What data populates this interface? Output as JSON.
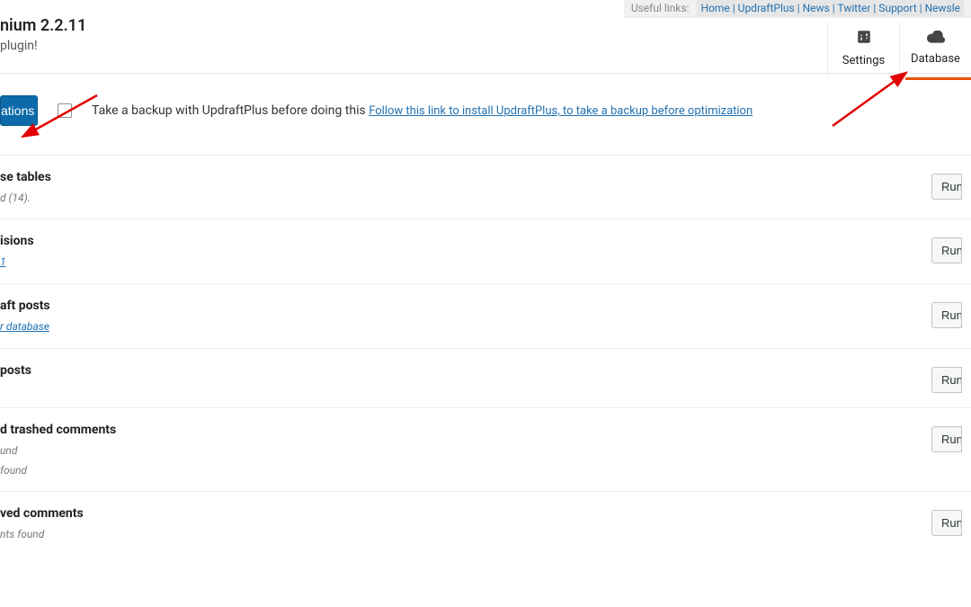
{
  "top_links": {
    "useful": "Useful links:",
    "items": [
      "Home",
      "UpdraftPlus",
      "News",
      "Twitter",
      "Support",
      "Newsle"
    ]
  },
  "header": {
    "title": "nium 2.2.11",
    "subtitle": "plugin!"
  },
  "tabs": {
    "settings": {
      "label": "Settings"
    },
    "database": {
      "label": "Database"
    }
  },
  "action": {
    "button": "ations",
    "backup_text": "Take a backup with UpdraftPlus before doing this",
    "backup_link": "Follow this link to install UpdraftPlus, to take a backup before optimization"
  },
  "run_label": "Run",
  "opts": [
    {
      "title": "se tables",
      "desc": "d (14).",
      "desc_is_link": false
    },
    {
      "title": "isions",
      "desc": "1",
      "desc_is_link": true
    },
    {
      "title": "aft posts",
      "desc": "r database",
      "desc_is_link": true
    },
    {
      "title": "posts",
      "desc": "",
      "desc_is_link": false
    },
    {
      "title": "d trashed comments",
      "desc": "und",
      "desc2": "found",
      "desc_is_link": false
    },
    {
      "title": "ved comments",
      "desc": "nts found",
      "desc_is_link": false
    }
  ]
}
